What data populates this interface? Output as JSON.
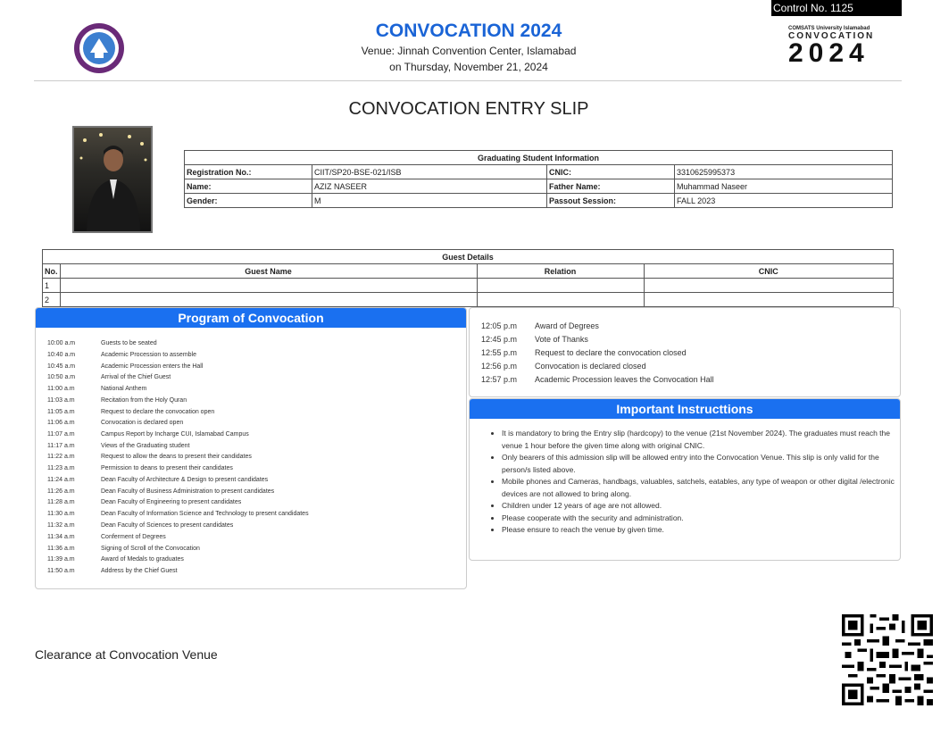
{
  "control_no": "Control No. 1125",
  "header": {
    "title": "CONVOCATION 2024",
    "venue": "Venue: Jinnah Convention Center, Islamabad",
    "date": "on Thursday, November 21, 2024",
    "logo_left_icon": "university-seal-icon",
    "brand_small": "COMSATS University Islamabad",
    "brand_conv": "CONVOCATION",
    "brand_year": "2024",
    "accent_color": "#1a64d6"
  },
  "slip_title": "CONVOCATION ENTRY SLIP",
  "student": {
    "section_title": "Graduating Student Information",
    "rows": [
      {
        "l1": "Registration No.:",
        "v1": "CIIT/SP20-BSE-021/ISB",
        "l2": "CNIC:",
        "v2": "3310625995373"
      },
      {
        "l1": "Name:",
        "v1": "AZIZ NASEER",
        "l2": "Father Name:",
        "v2": "Muhammad Naseer"
      },
      {
        "l1": "Gender:",
        "v1": "M",
        "l2": "Passout Session:",
        "v2": "FALL 2023"
      }
    ]
  },
  "guests": {
    "section_title": "Guest Details",
    "headers": [
      "No.",
      "Guest Name",
      "Relation",
      "CNIC"
    ],
    "rows": [
      {
        "no": "1",
        "name": "",
        "relation": "",
        "cnic": ""
      },
      {
        "no": "2",
        "name": "",
        "relation": "",
        "cnic": ""
      }
    ]
  },
  "program": {
    "title": "Program of Convocation",
    "items": [
      {
        "time": "10:00 a.m",
        "event": "Guests to be seated"
      },
      {
        "time": "10:40 a.m",
        "event": "Academic Procession to assemble"
      },
      {
        "time": "10:45 a.m",
        "event": "Academic Procession enters the Hall"
      },
      {
        "time": "10:50 a.m",
        "event": "Arrival of the Chief Guest"
      },
      {
        "time": "11:00 a.m",
        "event": "National Anthem"
      },
      {
        "time": "11:03 a.m",
        "event": "Recitation from the Holy Quran"
      },
      {
        "time": "11:05 a.m",
        "event": "Request to declare the convocation open"
      },
      {
        "time": "11:06 a.m",
        "event": "Convocation is declared open"
      },
      {
        "time": "11:07 a.m",
        "event": "Campus Report by Incharge CUI, Islamabad Campus"
      },
      {
        "time": "11:17 a.m",
        "event": "Views of the Graduating student"
      },
      {
        "time": "11:22 a.m",
        "event": "Request to allow the deans to present their candidates"
      },
      {
        "time": "11:23 a.m",
        "event": "Permission to deans to present their candidates"
      },
      {
        "time": "11:24 a.m",
        "event": "Dean Faculty of Architecture & Design to present candidates"
      },
      {
        "time": "11:26 a.m",
        "event": "Dean Faculty of Business Administration to present candidates"
      },
      {
        "time": "11:28 a.m",
        "event": "Dean Faculty of Engineering to present candidates"
      },
      {
        "time": "11:30 a.m",
        "event": "Dean Faculty of Information Science and Technology to present candidates"
      },
      {
        "time": "11:32 a.m",
        "event": "Dean Faculty of Sciences to present candidates"
      },
      {
        "time": "11:34 a.m",
        "event": "Conferment of Degrees"
      },
      {
        "time": "11:36 a.m",
        "event": "Signing of Scroll of the Convocation"
      },
      {
        "time": "11:39 a.m",
        "event": "Award of Medals to graduates"
      },
      {
        "time": "11:50 a.m",
        "event": "Address by the Chief Guest"
      }
    ],
    "items_continued": [
      {
        "time": "12:05 p.m",
        "event": "Award of Degrees"
      },
      {
        "time": "12:45 p.m",
        "event": "Vote of Thanks"
      },
      {
        "time": "12:55 p.m",
        "event": "Request to declare the convocation closed"
      },
      {
        "time": "12:56 p.m",
        "event": "Convocation is declared closed"
      },
      {
        "time": "12:57 p.m",
        "event": "Academic Procession leaves the Convocation Hall"
      }
    ]
  },
  "instructions": {
    "title": "Important Instructtions",
    "items": [
      "It is mandatory to bring the Entry slip (hardcopy) to the venue (21st November 2024). The graduates must reach the venue 1 hour before the given time along with original CNIC.",
      "Only bearers of this admission slip will be allowed entry into the Convocation Venue. This slip is only valid for the person/s listed above.",
      "Mobile phones and Cameras, handbags, valuables, satchels, eatables, any type of weapon or other digital /electronic devices are not allowed to bring along.",
      "Children under 12 years of age are not allowed.",
      "Please cooperate with the security and administration.",
      "Please ensure to reach the venue by given time."
    ]
  },
  "clearance": "Clearance at Convocation Venue",
  "qr_icon": "qr-code-icon"
}
